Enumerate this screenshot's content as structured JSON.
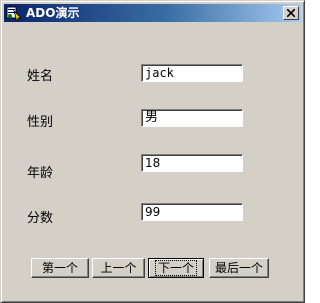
{
  "window": {
    "title": "ADO演示",
    "icon": "ado-app-icon",
    "close_icon": "close-icon"
  },
  "form": {
    "fields": [
      {
        "label": "姓名",
        "value": "jack"
      },
      {
        "label": "性别",
        "value": "男"
      },
      {
        "label": "年龄",
        "value": "18"
      },
      {
        "label": "分数",
        "value": "99"
      }
    ]
  },
  "nav": {
    "first": "第一个",
    "prev": "上一个",
    "next": "下一个",
    "last": "最后一个"
  }
}
